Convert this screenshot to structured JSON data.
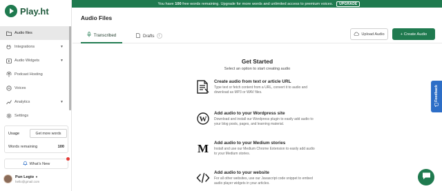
{
  "banner": {
    "text_pre": "You have ",
    "text_bold": "100",
    "text_post": " free words remaining. Upgrade for more words and unlimited access to premium voices.",
    "upgrade_label": "UPGRADE"
  },
  "brand": {
    "name": "Play.ht",
    "color": "#1f7a4f"
  },
  "sidebar": {
    "items": [
      {
        "label": "Audio files",
        "icon": "folder-icon",
        "active": true,
        "has_chevron": false
      },
      {
        "label": "Integrations",
        "icon": "plug-icon",
        "active": false,
        "has_chevron": true
      },
      {
        "label": "Audio Widgets",
        "icon": "widget-icon",
        "active": false,
        "has_chevron": true
      },
      {
        "label": "Podcast Hosting",
        "icon": "podcast-icon",
        "active": false,
        "has_chevron": false
      },
      {
        "label": "Voices",
        "icon": "voices-icon",
        "active": false,
        "has_chevron": false
      },
      {
        "label": "Analytics",
        "icon": "analytics-icon",
        "active": false,
        "has_chevron": true
      },
      {
        "label": "Settings",
        "icon": "gear-icon",
        "active": false,
        "has_chevron": false
      }
    ],
    "usage": {
      "label": "Usage",
      "get_more_label": "Get more words",
      "words_label": "Words remaining",
      "words_value": "100"
    },
    "whats_new_label": "What's New",
    "user": {
      "name": "Pun Legio",
      "email": "hello@gmail.com"
    }
  },
  "main": {
    "title": "Audio Files",
    "tabs": [
      {
        "label": "Transcribed",
        "active": true
      },
      {
        "label": "Drafts",
        "badge": "i",
        "active": false
      }
    ],
    "upload_label": "Upload Audio",
    "create_label": "+ Create Audio",
    "get_started": {
      "title": "Get Started",
      "subtitle": "Select an option to start creating audio"
    },
    "options": [
      {
        "title": "Create audio from text or article URL",
        "desc": "Type text or fetch content from a URL, convert it to audio and download as MP3 or WAV files.",
        "icon": "document-icon"
      },
      {
        "title": "Add audio to your Wordpress site",
        "desc": "Download and install our Wordpress plugin to easily add audio to your blog posts, pages, and learning material.",
        "icon": "wordpress-icon"
      },
      {
        "title": "Add audio to your Medium stories",
        "desc": "Install and use our Medium Chrome Extension to easily add audio to your Medium stories.",
        "icon": "medium-icon"
      },
      {
        "title": "Add audio to your website",
        "desc": "For all other websites, use our Javascript code snippet to embed audio player widgets in your articles.",
        "icon": "code-icon"
      }
    ]
  },
  "feedback_label": "Feedback",
  "colors": {
    "accent": "#1f7a4f",
    "feedback": "#2d6ec7",
    "notify": "#e53935"
  }
}
